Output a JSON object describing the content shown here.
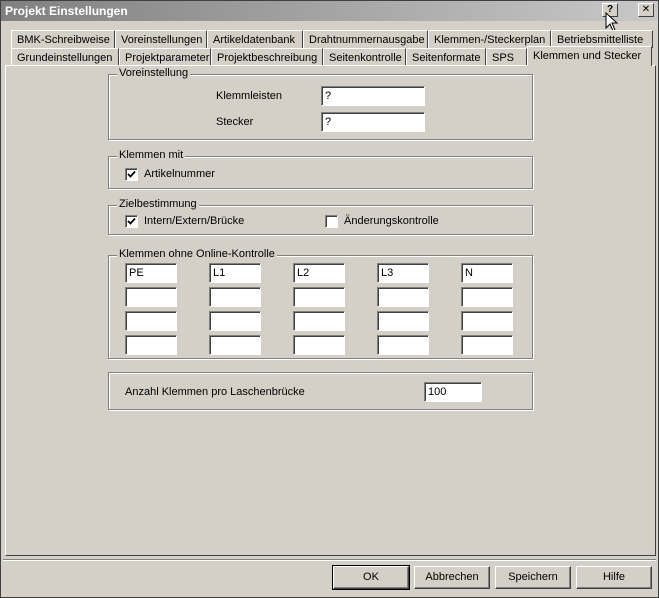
{
  "window": {
    "title": "Projekt Einstellungen"
  },
  "titlebar_buttons": {
    "help": "?",
    "close": "✕"
  },
  "tabs_row1": [
    "BMK-Schreibweise",
    "Voreinstellungen",
    "Artikeldatenbank",
    "Drahtnummernausgabe",
    "Klemmen-/Steckerplan",
    "Betriebsmittelliste"
  ],
  "tabs_row2": [
    "Grundeinstellungen",
    "Projektparameter",
    "Projektbeschreibung",
    "Seitenkontrolle",
    "Seitenformate",
    "SPS",
    "Klemmen und Stecker"
  ],
  "active_tab": "Klemmen und Stecker",
  "voreinstellung": {
    "title": "Voreinstellung",
    "klemmleisten_label": "Klemmleisten",
    "klemmleisten_value": "?",
    "stecker_label": "Stecker",
    "stecker_value": "?"
  },
  "klemmen_mit": {
    "title": "Klemmen mit",
    "artikelnummer_label": "Artikelnummer",
    "artikelnummer_checked": true
  },
  "zielbestimmung": {
    "title": "Zielbestimmung",
    "intern_label": "Intern/Extern/Brücke",
    "intern_checked": true,
    "aenderung_label": "Änderungskontrolle",
    "aenderung_checked": false
  },
  "online": {
    "title": "Klemmen ohne Online-Kontrolle",
    "rows": [
      [
        "PE",
        "L1",
        "L2",
        "L3",
        "N"
      ],
      [
        "",
        "",
        "",
        "",
        ""
      ],
      [
        "",
        "",
        "",
        "",
        ""
      ],
      [
        "",
        "",
        "",
        "",
        ""
      ]
    ]
  },
  "laschen": {
    "label": "Anzahl Klemmen pro Laschenbrücke",
    "value": "100"
  },
  "buttons": {
    "ok": "OK",
    "cancel": "Abbrechen",
    "save": "Speichern",
    "help": "Hilfe"
  }
}
